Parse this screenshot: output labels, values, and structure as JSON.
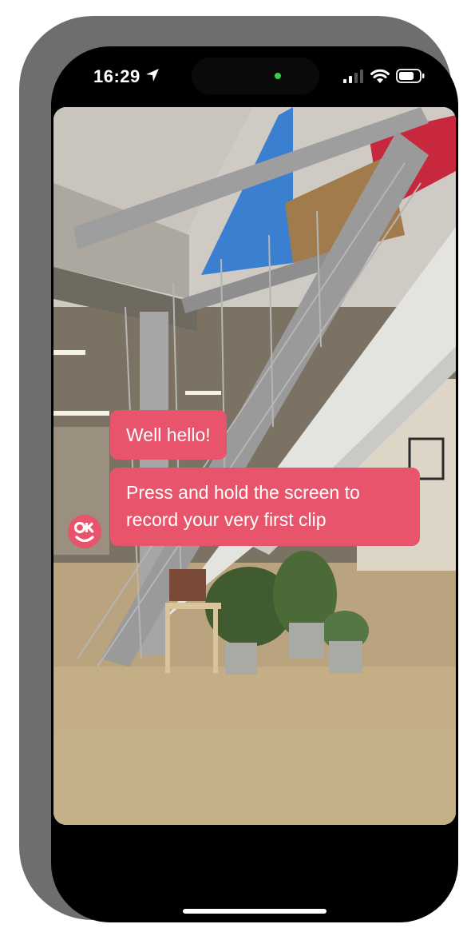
{
  "status_bar": {
    "time": "16:29",
    "icons": [
      "location-arrow-icon",
      "cellular-signal-icon",
      "wifi-icon",
      "battery-icon"
    ],
    "camera_indicator_color": "#35d04a"
  },
  "messages": [
    {
      "text": "Well hello!"
    },
    {
      "lines": [
        "Press and hold the screen to",
        "record your very first clip"
      ]
    }
  ],
  "avatar": {
    "logo_text": "OK",
    "icon": "ok-smiley-avatar-icon"
  },
  "colors": {
    "accent": "#e8546b",
    "frame": "#6e6e6e",
    "screen": "#000000"
  }
}
